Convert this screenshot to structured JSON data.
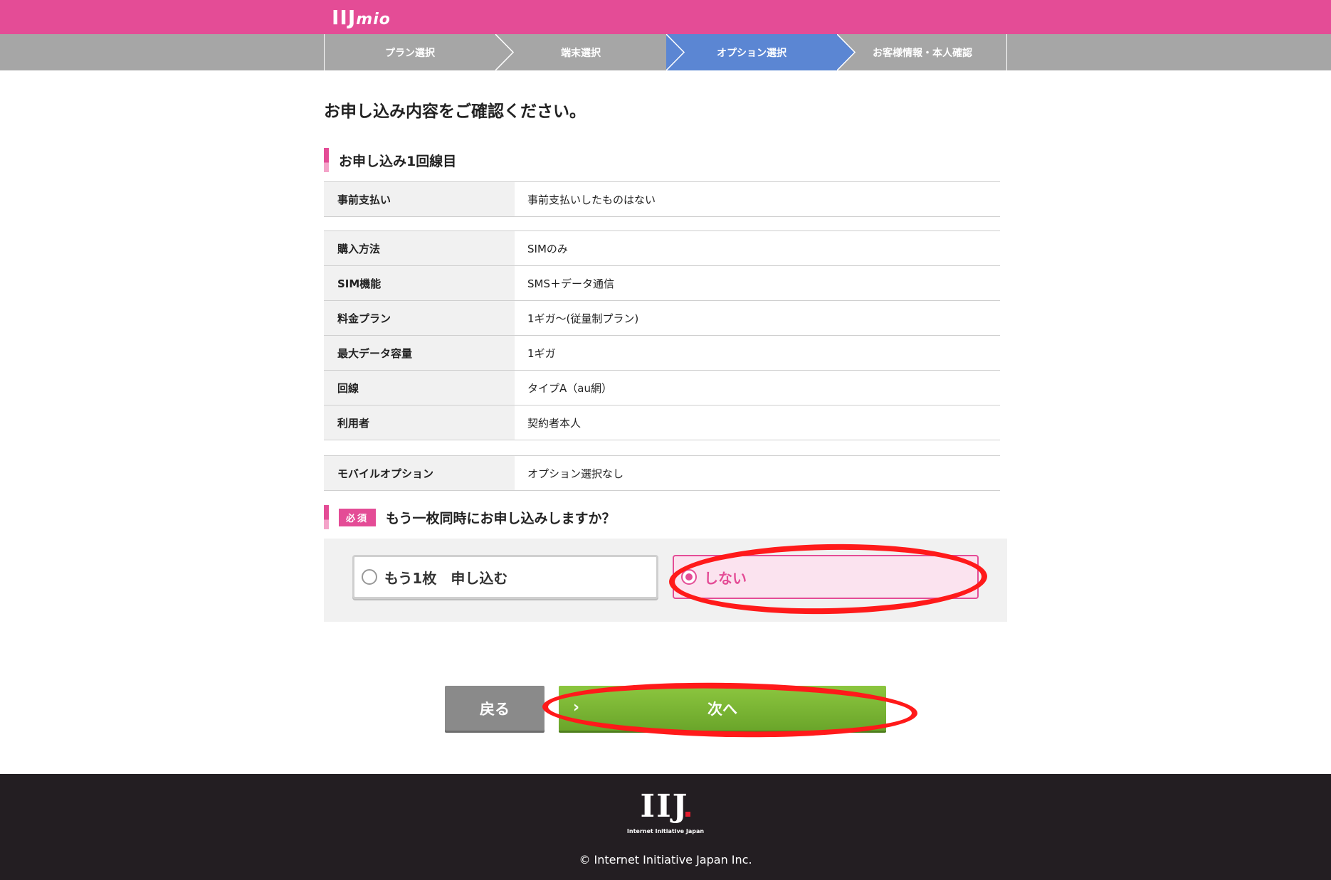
{
  "header": {
    "logo_main": "IIJ",
    "logo_sub": "mio"
  },
  "steps": [
    {
      "label": "プラン選択",
      "active": false
    },
    {
      "label": "端末選択",
      "active": false
    },
    {
      "label": "オプション選択",
      "active": true
    },
    {
      "label": "お客様情報・本人確認",
      "active": false
    }
  ],
  "page_title": "お申し込み内容をご確認ください。",
  "section1": {
    "title": "お申し込み1回線目",
    "group1": [
      {
        "label": "事前支払い",
        "value": "事前支払いしたものはない"
      }
    ],
    "group2": [
      {
        "label": "購入方法",
        "value": "SIMのみ"
      },
      {
        "label": "SIM機能",
        "value": "SMS＋データ通信"
      },
      {
        "label": "料金プラン",
        "value": "1ギガ〜(従量制プラン)"
      },
      {
        "label": "最大データ容量",
        "value": "1ギガ"
      },
      {
        "label": "回線",
        "value": "タイプA（au網）"
      },
      {
        "label": "利用者",
        "value": "契約者本人"
      }
    ],
    "group3": [
      {
        "label": "モバイルオプション",
        "value": "オプション選択なし"
      }
    ]
  },
  "question": {
    "required_label": "必須",
    "text": "もう一枚同時にお申し込みしますか？",
    "option_yes": "もう1枚　申し込む",
    "option_no": "しない",
    "selected": "option_no"
  },
  "buttons": {
    "back": "戻る",
    "next": "次へ",
    "next_chevron": "›"
  },
  "footer": {
    "logo": "IIJ",
    "logo_sub": "Internet Initiative Japan",
    "copyright": "© Internet Initiative Japan Inc."
  },
  "colors": {
    "brand_pink": "#e44c96",
    "step_active": "#5b86d3",
    "next_green": "#7ab634",
    "annotation_red": "#ff1a1a"
  }
}
